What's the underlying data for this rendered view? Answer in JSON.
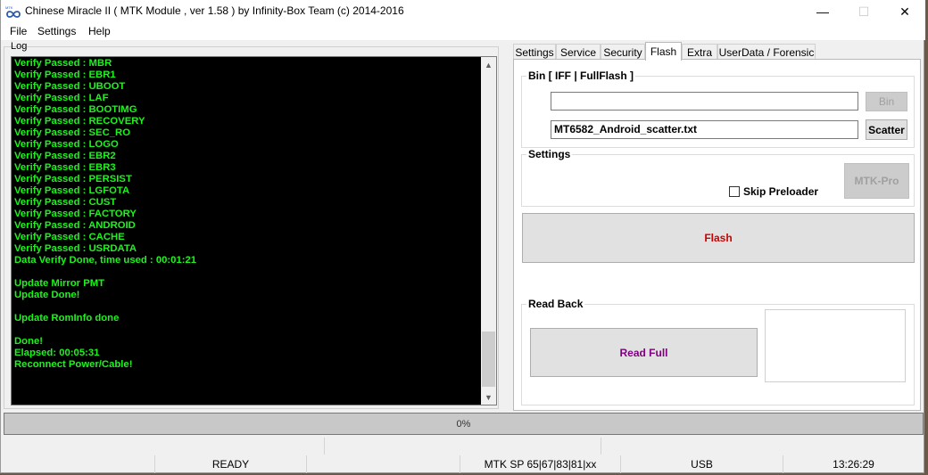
{
  "window": {
    "title": "Chinese Miracle II ( MTK Module , ver 1.58 ) by Infinity-Box Team (c) 2014-2016",
    "icon": "infinity-logo-icon"
  },
  "menu": [
    "File",
    "Settings",
    "Help"
  ],
  "log": {
    "label": "Log",
    "lines": [
      "Verify Passed : MBR",
      "Verify Passed : EBR1",
      "Verify Passed : UBOOT",
      "Verify Passed : LAF",
      "Verify Passed : BOOTIMG",
      "Verify Passed : RECOVERY",
      "Verify Passed : SEC_RO",
      "Verify Passed : LOGO",
      "Verify Passed : EBR2",
      "Verify Passed : EBR3",
      "Verify Passed : PERSIST",
      "Verify Passed : LGFOTA",
      "Verify Passed : CUST",
      "Verify Passed : FACTORY",
      "Verify Passed : ANDROID",
      "Verify Passed : CACHE",
      "Verify Passed : USRDATA",
      "Data Verify Done, time used : 00:01:21",
      "",
      "Update Mirror PMT",
      "Update Done!",
      "",
      "Update RomInfo done",
      "",
      "Done!",
      "Elapsed: 00:05:31",
      "Reconnect Power/Cable!"
    ],
    "text_color": "#1cf41c"
  },
  "tabs": [
    "Settings",
    "Service",
    "Security",
    "Flash",
    "Extra",
    "UserData / Forensic"
  ],
  "active_tab": "Flash",
  "flash": {
    "bin_group_title": "Bin  [ IFF | FullFlash ]",
    "bin_path": "",
    "bin_button": "Bin",
    "scatter_path": "MT6582_Android_scatter.txt",
    "scatter_button": "Scatter",
    "settings_group_title": "Settings",
    "skip_preloader_label": "Skip Preloader",
    "skip_preloader_checked": false,
    "mtk_pro_button": "MTK-Pro",
    "flash_button": "Flash",
    "flash_color": "#cc0000",
    "readback_group_title": "Read Back",
    "read_full_button": "Read Full",
    "read_full_color": "#800080"
  },
  "progress": {
    "label": "0%",
    "value": 0
  },
  "status": {
    "state": "READY",
    "chip": "MTK SP 65|67|83|81|xx",
    "connection": "USB",
    "time": "13:26:29"
  }
}
